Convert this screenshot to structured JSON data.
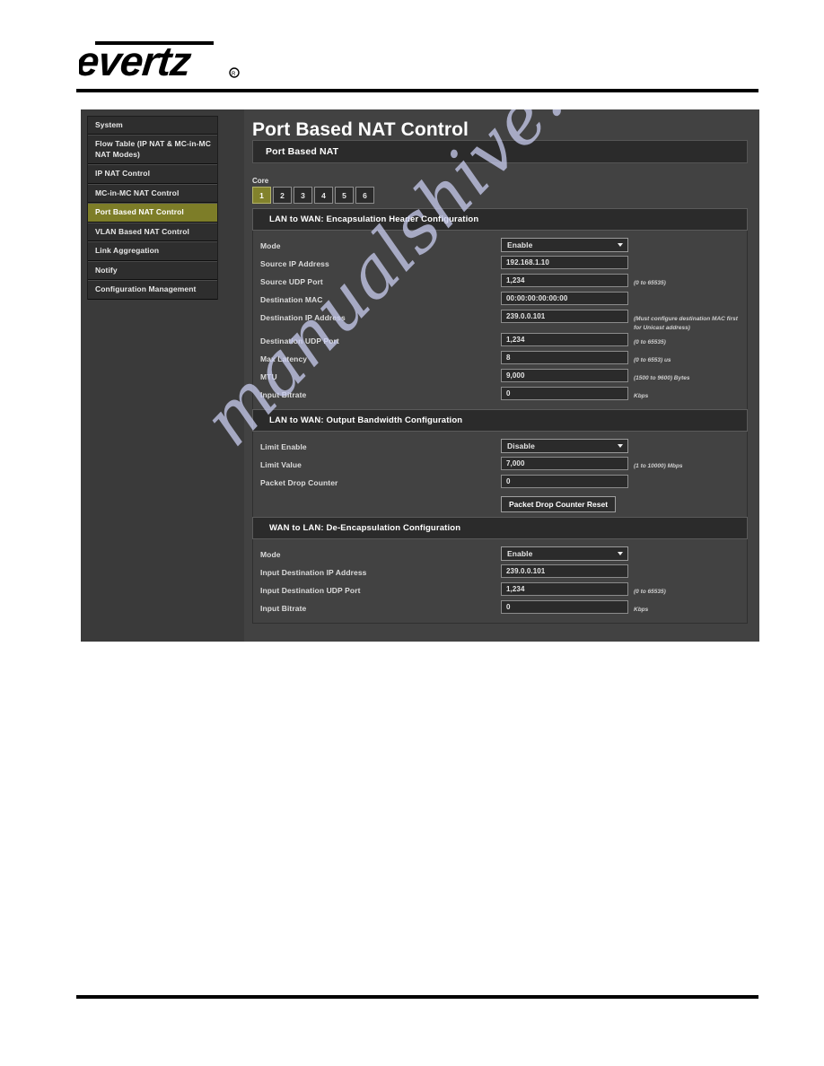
{
  "brand": {
    "logo_text": "evertz",
    "trademark": "®"
  },
  "watermark": {
    "text": "manualshive.com"
  },
  "sidebar": {
    "items": [
      {
        "label": "System",
        "selected": false
      },
      {
        "label": "Flow Table (IP NAT & MC-in-MC NAT Modes)",
        "selected": false
      },
      {
        "label": "IP NAT Control",
        "selected": false
      },
      {
        "label": "MC-in-MC NAT Control",
        "selected": false
      },
      {
        "label": "Port Based NAT Control",
        "selected": true
      },
      {
        "label": "VLAN Based NAT Control",
        "selected": false
      },
      {
        "label": "Link Aggregation",
        "selected": false
      },
      {
        "label": "Notify",
        "selected": false
      },
      {
        "label": "Configuration Management",
        "selected": false
      }
    ]
  },
  "header": {
    "title": "Port Based NAT Control",
    "panel_title": "Port Based NAT"
  },
  "core": {
    "label": "Core",
    "tabs": [
      "1",
      "2",
      "3",
      "4",
      "5",
      "6"
    ],
    "selected": "1"
  },
  "colors": {
    "accent_olive": "#82822c",
    "panel_bg": "#424242",
    "field_bg": "#2b2b2b",
    "header_bar": "#2b2b2b"
  },
  "sections": [
    {
      "title": "LAN to WAN: Encapsulation Header Configuration",
      "rows": [
        {
          "label": "Mode",
          "type": "dropdown",
          "value": "Enable",
          "hint": ""
        },
        {
          "label": "Source IP Address",
          "type": "text",
          "value": "192.168.1.10",
          "hint": ""
        },
        {
          "label": "Source UDP Port",
          "type": "text",
          "value": "1,234",
          "hint": "(0 to 65535)"
        },
        {
          "label": "Destination MAC",
          "type": "text",
          "value": "00:00:00:00:00:00",
          "hint": ""
        },
        {
          "label": "Destination IP Address",
          "type": "text",
          "value": "239.0.0.101",
          "hint": "(Must configure destination MAC first for Unicast address)"
        },
        {
          "label": "Destination UDP Port",
          "type": "text",
          "value": "1,234",
          "hint": "(0 to 65535)"
        },
        {
          "label": "Max Latency",
          "type": "text",
          "value": "8",
          "hint": "(0 to 6553) us"
        },
        {
          "label": "MTU",
          "type": "text",
          "value": "9,000",
          "hint": "(1500 to 9600) Bytes"
        },
        {
          "label": "Input Bitrate",
          "type": "text",
          "value": "0",
          "hint": "Kbps"
        }
      ]
    },
    {
      "title": "LAN to WAN: Output Bandwidth Configuration",
      "rows": [
        {
          "label": "Limit Enable",
          "type": "dropdown",
          "value": "Disable",
          "hint": ""
        },
        {
          "label": "Limit Value",
          "type": "text",
          "value": "7,000",
          "hint": "(1 to 10000) Mbps"
        },
        {
          "label": "Packet Drop Counter",
          "type": "text",
          "value": "0",
          "hint": ""
        }
      ],
      "button": "Packet Drop Counter Reset"
    },
    {
      "title": "WAN to LAN: De-Encapsulation Configuration",
      "rows": [
        {
          "label": "Mode",
          "type": "dropdown",
          "value": "Enable",
          "hint": ""
        },
        {
          "label": "Input Destination IP Address",
          "type": "text",
          "value": "239.0.0.101",
          "hint": ""
        },
        {
          "label": "Input Destination UDP Port",
          "type": "text",
          "value": "1,234",
          "hint": "(0 to 65535)"
        },
        {
          "label": "Input Bitrate",
          "type": "text",
          "value": "0",
          "hint": "Kbps"
        }
      ]
    }
  ]
}
